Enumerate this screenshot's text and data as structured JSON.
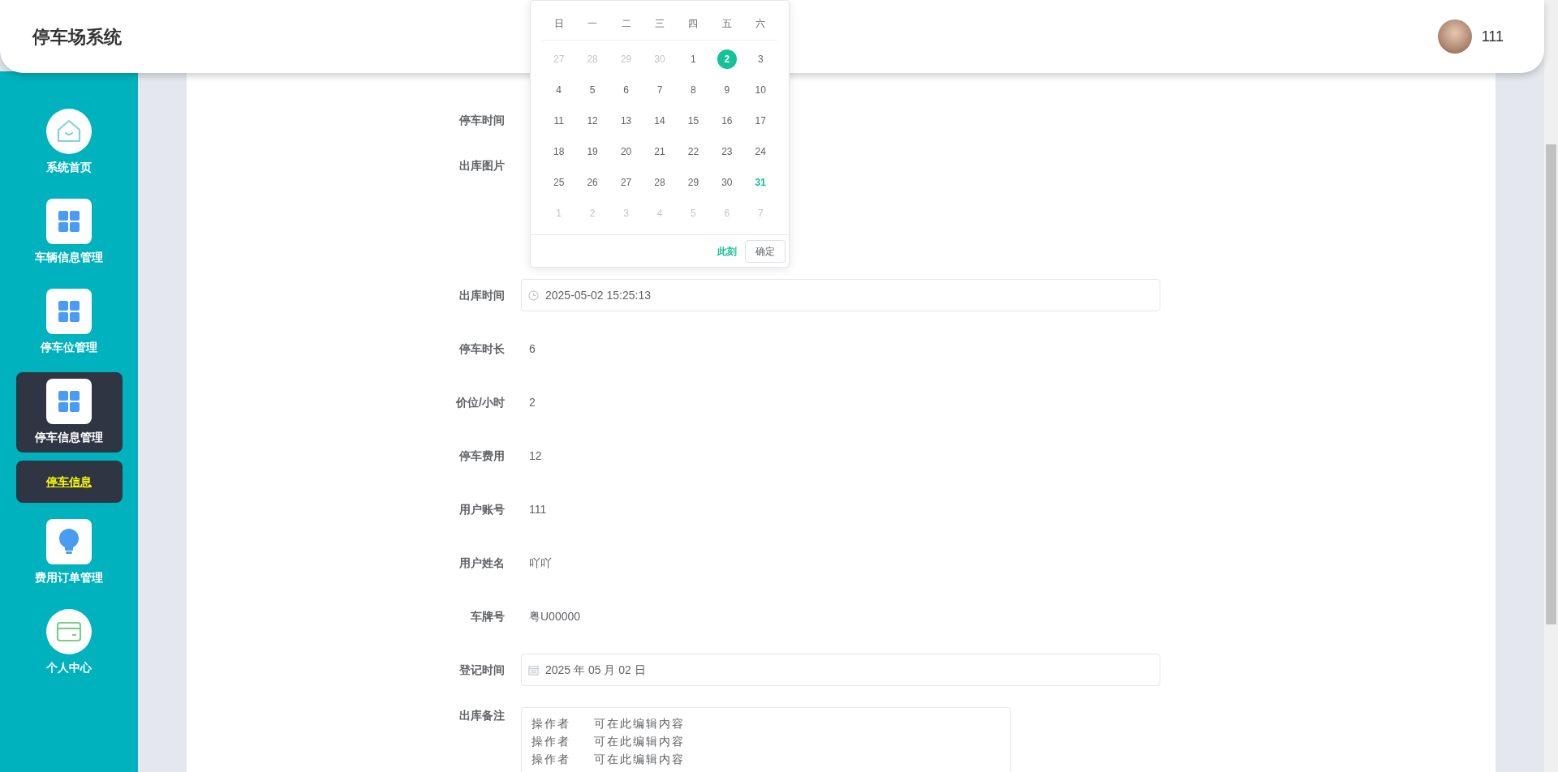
{
  "header": {
    "title": "停车场系统",
    "user": {
      "name": "111"
    }
  },
  "sidebar": {
    "items": [
      {
        "label": "系统首页",
        "kind": "home",
        "selected": false
      },
      {
        "label": "车辆信息管理",
        "kind": "grid",
        "selected": false
      },
      {
        "label": "停车位管理",
        "kind": "grid",
        "selected": false
      },
      {
        "label": "停车信息管理",
        "kind": "grid",
        "selected": true,
        "children": [
          {
            "label": "停车信息",
            "selected": true
          }
        ]
      },
      {
        "label": "费用订单管理",
        "kind": "bulb",
        "selected": false
      },
      {
        "label": "个人中心",
        "kind": "card",
        "selected": false
      }
    ]
  },
  "form": {
    "rows": [
      {
        "kind": "covered",
        "label": "停车时间"
      },
      {
        "kind": "image",
        "label": "出库图片"
      },
      {
        "kind": "datetime",
        "label": "出库时间",
        "value": "2025-05-02 15:25:13"
      },
      {
        "kind": "text",
        "label": "停车时长",
        "value": "6"
      },
      {
        "kind": "text",
        "label": "价位/小时",
        "value": "2"
      },
      {
        "kind": "text",
        "label": "停车费用",
        "value": "12"
      },
      {
        "kind": "text",
        "label": "用户账号",
        "value": "111"
      },
      {
        "kind": "text",
        "label": "用户姓名",
        "value": "吖吖"
      },
      {
        "kind": "text",
        "label": "车牌号",
        "value": "粤U00000"
      },
      {
        "kind": "date",
        "label": "登记时间",
        "value": "2025 年 05 月 02 日"
      },
      {
        "kind": "textarea",
        "label": "出库备注",
        "lines": [
          "操作者     可在此编辑内容",
          "操作者     可在此编辑内容",
          "操作者     可在此编辑内容"
        ]
      }
    ]
  },
  "date_picker": {
    "weekdays": [
      "日",
      "一",
      "二",
      "三",
      "四",
      "五",
      "六"
    ],
    "weeks": [
      [
        {
          "day": "27",
          "kind": "other",
          "selected": false
        },
        {
          "day": "28",
          "kind": "other",
          "selected": false
        },
        {
          "day": "29",
          "kind": "other",
          "selected": false
        },
        {
          "day": "30",
          "kind": "other",
          "selected": false
        },
        {
          "day": "1",
          "kind": "current",
          "selected": false
        },
        {
          "day": "2",
          "kind": "current",
          "selected": true
        },
        {
          "day": "3",
          "kind": "current",
          "selected": false
        }
      ],
      [
        {
          "day": "4",
          "kind": "current",
          "selected": false
        },
        {
          "day": "5",
          "kind": "current",
          "selected": false
        },
        {
          "day": "6",
          "kind": "current",
          "selected": false
        },
        {
          "day": "7",
          "kind": "current",
          "selected": false
        },
        {
          "day": "8",
          "kind": "current",
          "selected": false
        },
        {
          "day": "9",
          "kind": "current",
          "selected": false
        },
        {
          "day": "10",
          "kind": "current",
          "selected": false
        }
      ],
      [
        {
          "day": "11",
          "kind": "current",
          "selected": false
        },
        {
          "day": "12",
          "kind": "current",
          "selected": false
        },
        {
          "day": "13",
          "kind": "current",
          "selected": false
        },
        {
          "day": "14",
          "kind": "current",
          "selected": false
        },
        {
          "day": "15",
          "kind": "current",
          "selected": false
        },
        {
          "day": "16",
          "kind": "current",
          "selected": false
        },
        {
          "day": "17",
          "kind": "current",
          "selected": false
        }
      ],
      [
        {
          "day": "18",
          "kind": "current",
          "selected": false
        },
        {
          "day": "19",
          "kind": "current",
          "selected": false
        },
        {
          "day": "20",
          "kind": "current",
          "selected": false
        },
        {
          "day": "21",
          "kind": "current",
          "selected": false
        },
        {
          "day": "22",
          "kind": "current",
          "selected": false
        },
        {
          "day": "23",
          "kind": "current",
          "selected": false
        },
        {
          "day": "24",
          "kind": "current",
          "selected": false
        }
      ],
      [
        {
          "day": "25",
          "kind": "current",
          "selected": false
        },
        {
          "day": "26",
          "kind": "current",
          "selected": false
        },
        {
          "day": "27",
          "kind": "current",
          "selected": false
        },
        {
          "day": "28",
          "kind": "current",
          "selected": false
        },
        {
          "day": "29",
          "kind": "current",
          "selected": false
        },
        {
          "day": "30",
          "kind": "current",
          "selected": false
        },
        {
          "day": "31",
          "kind": "today",
          "selected": false
        }
      ],
      [
        {
          "day": "1",
          "kind": "other",
          "selected": false
        },
        {
          "day": "2",
          "kind": "other",
          "selected": false
        },
        {
          "day": "3",
          "kind": "other",
          "selected": false
        },
        {
          "day": "4",
          "kind": "other",
          "selected": false
        },
        {
          "day": "5",
          "kind": "other",
          "selected": false
        },
        {
          "day": "6",
          "kind": "other",
          "selected": false
        },
        {
          "day": "7",
          "kind": "other",
          "selected": false
        }
      ]
    ],
    "now_link": "此刻",
    "confirm_button": "确定"
  }
}
